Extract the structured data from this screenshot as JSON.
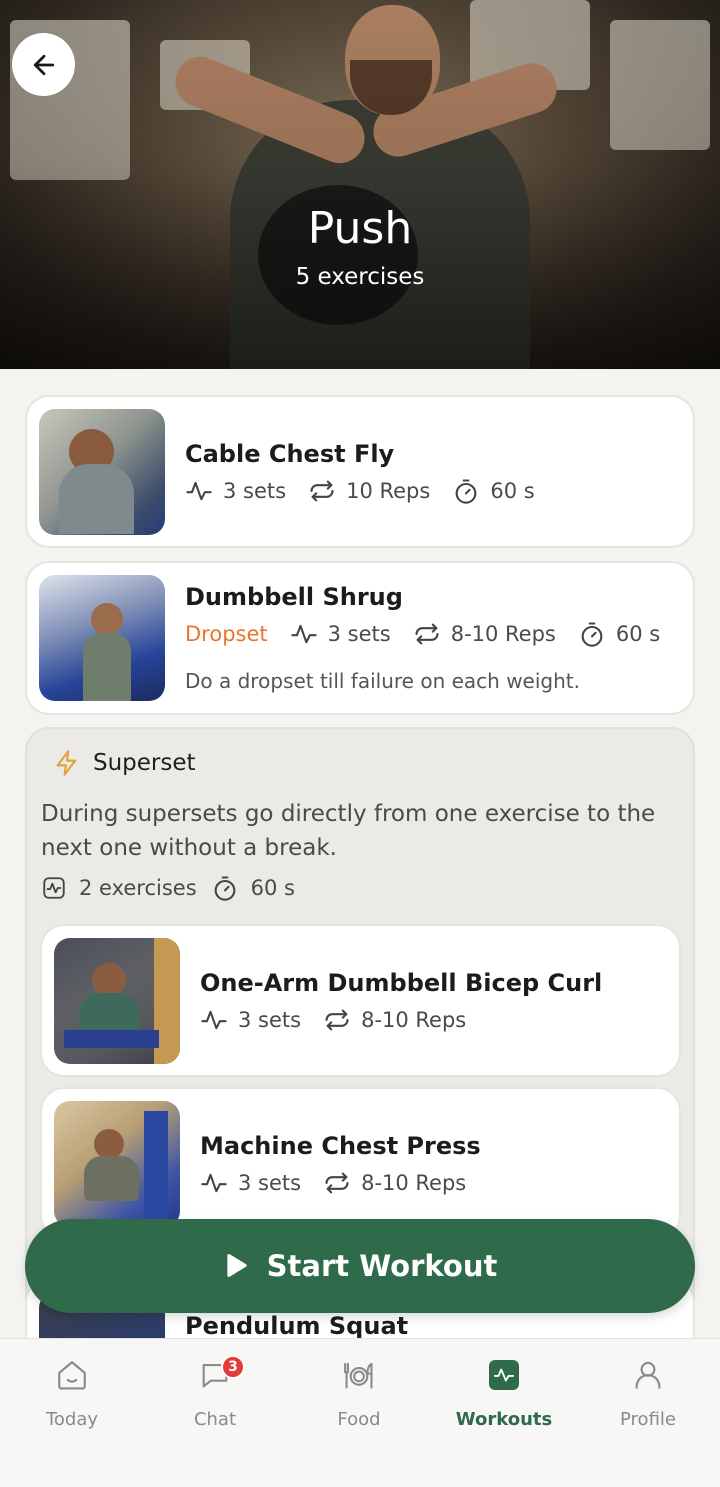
{
  "header": {
    "title": "Push",
    "subtitle": "5 exercises"
  },
  "exercises": [
    {
      "name": "Cable Chest Fly",
      "sets": "3 sets",
      "reps": "10 Reps",
      "rest": "60 s"
    },
    {
      "name": "Dumbbell Shrug",
      "tag": "Dropset",
      "sets": "3 sets",
      "reps": "8-10 Reps",
      "rest": "60 s",
      "note": "Do a dropset till failure on each weight."
    }
  ],
  "superset": {
    "label": "Superset",
    "description": "During supersets go directly from one exercise to the next one without a break.",
    "count": "2 exercises",
    "rest": "60 s",
    "items": [
      {
        "name": "One-Arm Dumbbell Bicep Curl",
        "sets": "3 sets",
        "reps": "8-10 Reps"
      },
      {
        "name": "Machine Chest Press",
        "sets": "3 sets",
        "reps": "8-10 Reps"
      }
    ]
  },
  "next_exercise": {
    "name": "Pendulum Squat"
  },
  "start_button": {
    "label": "Start Workout"
  },
  "nav": {
    "items": [
      {
        "label": "Today",
        "icon": "home-icon"
      },
      {
        "label": "Chat",
        "icon": "chat-icon",
        "badge": "3"
      },
      {
        "label": "Food",
        "icon": "food-icon"
      },
      {
        "label": "Workouts",
        "icon": "workouts-icon"
      },
      {
        "label": "Profile",
        "icon": "profile-icon"
      }
    ],
    "active": "Workouts"
  },
  "colors": {
    "accent": "#2f6b4a",
    "dropset": "#e8762c",
    "badge": "#e23b3b",
    "superset_icon": "#e0a23a"
  }
}
